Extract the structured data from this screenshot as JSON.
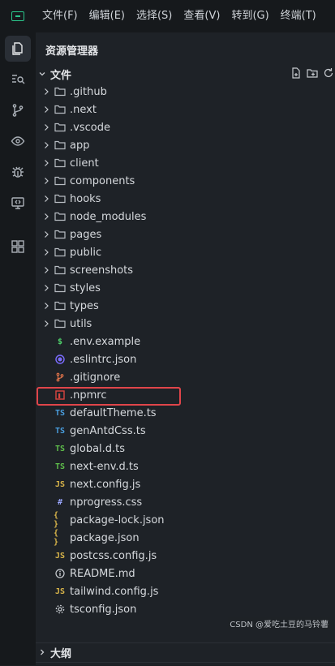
{
  "menu": [
    "文件(F)",
    "编辑(E)",
    "选择(S)",
    "查看(V)",
    "转到(G)",
    "终端(T)"
  ],
  "activity_icons": [
    "files-icon",
    "search-icon",
    "source-control-icon",
    "eye-icon",
    "debug-icon",
    "remote-explorer-icon",
    "extensions-icon"
  ],
  "explorer": {
    "title": "资源管理器",
    "section": "文件",
    "outline": "大纲",
    "highlighted_item": ".npmrc"
  },
  "files": [
    {
      "name": ".github",
      "kind": "folder"
    },
    {
      "name": ".next",
      "kind": "folder"
    },
    {
      "name": ".vscode",
      "kind": "folder"
    },
    {
      "name": "app",
      "kind": "folder"
    },
    {
      "name": "client",
      "kind": "folder"
    },
    {
      "name": "components",
      "kind": "folder"
    },
    {
      "name": "hooks",
      "kind": "folder"
    },
    {
      "name": "node_modules",
      "kind": "folder"
    },
    {
      "name": "pages",
      "kind": "folder"
    },
    {
      "name": "public",
      "kind": "folder"
    },
    {
      "name": "screenshots",
      "kind": "folder"
    },
    {
      "name": "styles",
      "kind": "folder"
    },
    {
      "name": "types",
      "kind": "folder"
    },
    {
      "name": "utils",
      "kind": "folder"
    },
    {
      "name": ".env.example",
      "kind": "env"
    },
    {
      "name": ".eslintrc.json",
      "kind": "eslint"
    },
    {
      "name": ".gitignore",
      "kind": "git"
    },
    {
      "name": ".npmrc",
      "kind": "npm"
    },
    {
      "name": "defaultTheme.ts",
      "kind": "ts"
    },
    {
      "name": "genAntdCss.ts",
      "kind": "ts"
    },
    {
      "name": "global.d.ts",
      "kind": "dts"
    },
    {
      "name": "next-env.d.ts",
      "kind": "dts"
    },
    {
      "name": "next.config.js",
      "kind": "js"
    },
    {
      "name": "nprogress.css",
      "kind": "css"
    },
    {
      "name": "package-lock.json",
      "kind": "json"
    },
    {
      "name": "package.json",
      "kind": "json"
    },
    {
      "name": "postcss.config.js",
      "kind": "js"
    },
    {
      "name": "README.md",
      "kind": "info"
    },
    {
      "name": "tailwind.config.js",
      "kind": "js"
    },
    {
      "name": "tsconfig.json",
      "kind": "gear"
    }
  ],
  "icon_text": {
    "ts": "TS",
    "dts": "TS",
    "js": "JS",
    "css": "#",
    "json": "{ }",
    "env": "$"
  },
  "colors": {
    "ts": "#4a9fe0",
    "dts": "#5fbf4b",
    "js": "#d8b44a",
    "css": "#9aa7ff",
    "json": "#d8b44a",
    "env": "#4fd16b",
    "eslint": "#7b6cff",
    "git": "#e0734a",
    "npm": "#d9453f",
    "info": "#c7cbd0",
    "gear": "#c7cbd0",
    "folder": "#b8bdc3"
  },
  "watermark": "CSDN @爱吃土豆的马铃薯"
}
